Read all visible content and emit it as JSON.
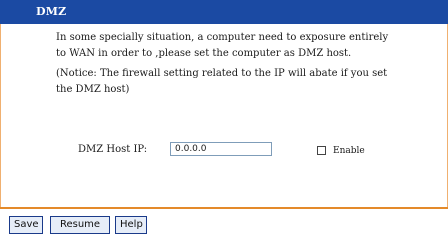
{
  "header": {
    "title": "DMZ"
  },
  "content": {
    "description": "In some specially situation, a computer need to exposure entirely to WAN in order to ,please set the computer as DMZ host.",
    "notice": "(Notice: The firewall setting related to the IP will abate if you set the DMZ host)"
  },
  "form": {
    "host_label": "DMZ Host IP:",
    "host_value": "0.0.0.0",
    "enable_label": "Enable",
    "enable_checked": false
  },
  "buttons": {
    "save": "Save",
    "resume": "Resume",
    "help": "Help"
  },
  "colors": {
    "header_bg": "#1b4aa3",
    "accent_border": "#e48a2a"
  }
}
